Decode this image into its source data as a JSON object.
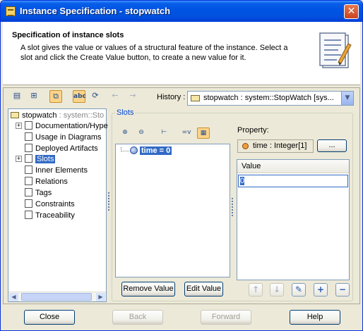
{
  "window": {
    "title": "Instance Specification - stopwatch",
    "close_glyph": "✕"
  },
  "header": {
    "title": "Specification of instance slots",
    "description": "A slot gives the value or values of a structural feature of the instance. Select a slot and click the Create Value button, to create a new value for it."
  },
  "toolbar": {
    "history_label": "History :",
    "history_value": "stopwatch : system::StopWatch [sys..."
  },
  "tree": {
    "root": {
      "name": "stopwatch",
      "type": " : system::Sto"
    },
    "items": [
      {
        "label": "Documentation/Hype",
        "expandable": true
      },
      {
        "label": "Usage in Diagrams",
        "expandable": false
      },
      {
        "label": "Deployed Artifacts",
        "expandable": false
      },
      {
        "label": "Slots",
        "expandable": true,
        "selected": true
      },
      {
        "label": "Inner Elements",
        "expandable": false
      },
      {
        "label": "Relations",
        "expandable": false
      },
      {
        "label": "Tags",
        "expandable": false
      },
      {
        "label": "Constraints",
        "expandable": false
      },
      {
        "label": "Traceability",
        "expandable": false
      }
    ]
  },
  "slots": {
    "group_label": "Slots",
    "list_items": [
      "time = 0"
    ],
    "remove_label": "Remove Value",
    "edit_label": "Edit Value"
  },
  "property": {
    "label": "Property:",
    "value": "time : Integer[1]",
    "more_label": "..."
  },
  "values": {
    "column_header": "Value",
    "cells": [
      "0"
    ]
  },
  "footer": {
    "close_label": "Close",
    "back_label": "Back",
    "forward_label": "Forward",
    "help_label": "Help"
  }
}
